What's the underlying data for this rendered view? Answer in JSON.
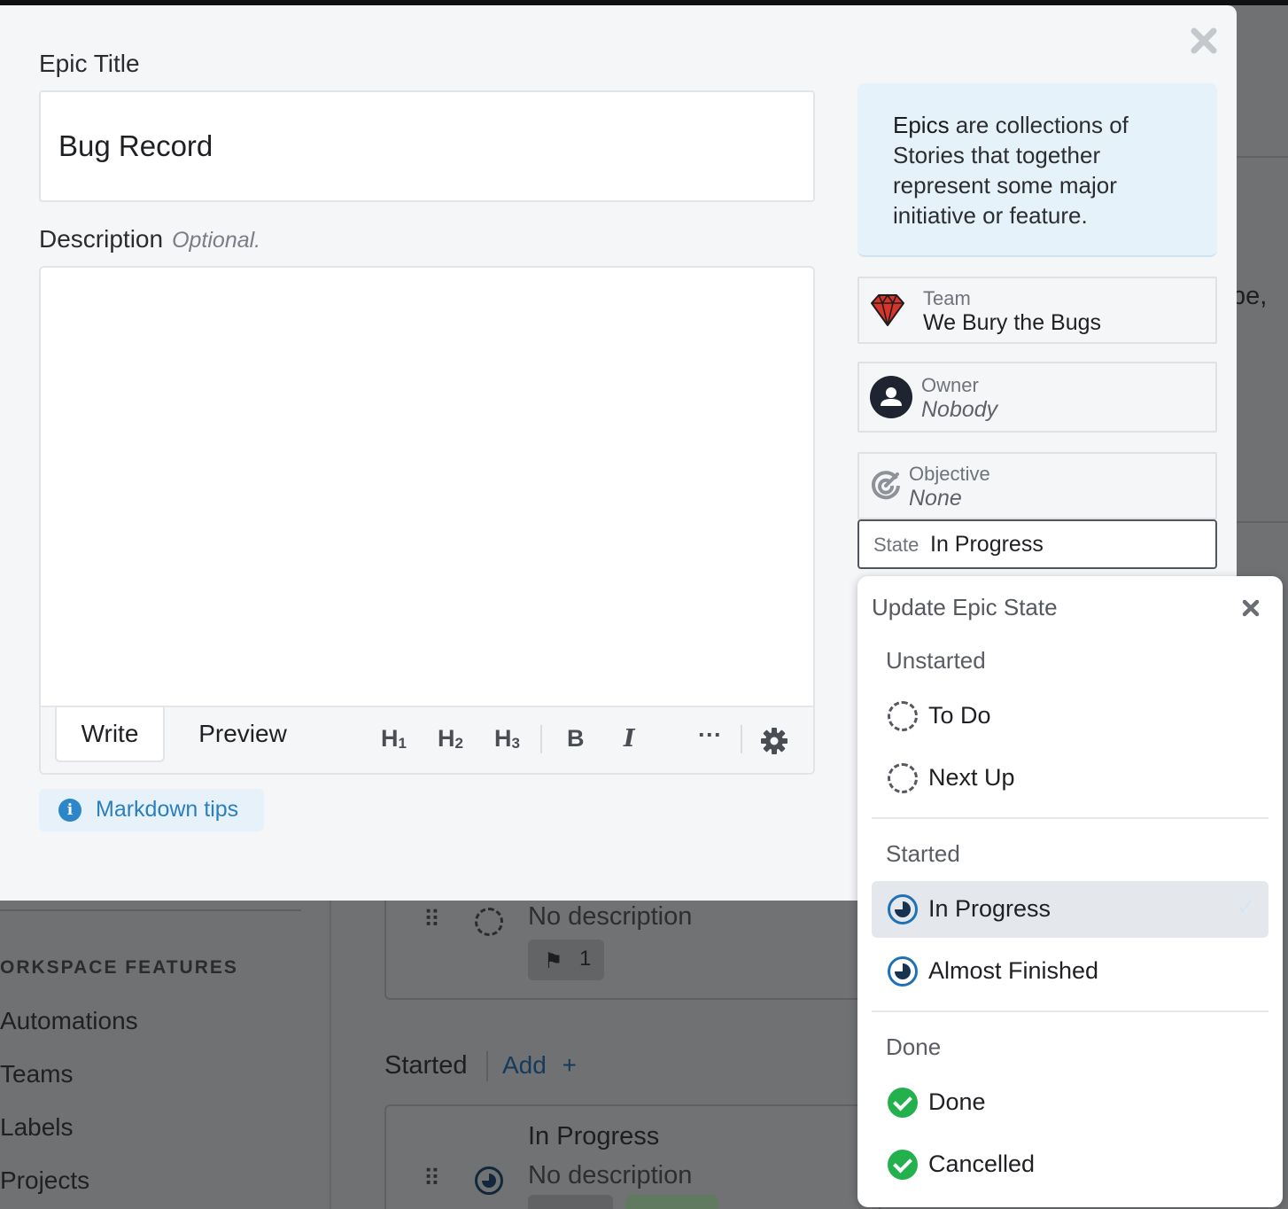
{
  "background": {
    "sidebar_section_title": "ORKSPACE FEATURES",
    "sidebar_items": [
      "Automations",
      "Teams",
      "Labels",
      "Projects"
    ],
    "card1": {
      "description": "No description",
      "flag_count": "1"
    },
    "column_header": "Started",
    "add_label": "Add",
    "add_icon": "+",
    "card2": {
      "title": "In Progress",
      "description": "No description"
    },
    "right_fragment": "be,"
  },
  "modal": {
    "epic_title_label": "Epic Title",
    "epic_title_value": "Bug Record",
    "description_label": "Description",
    "description_optional": "Optional.",
    "description_value": "",
    "editor": {
      "tabs": [
        "Write",
        "Preview"
      ],
      "tools": {
        "h1": "H",
        "h2": "H",
        "h3": "H",
        "h1_sub": "1",
        "h2_sub": "2",
        "h3_sub": "3",
        "bold": "B",
        "italic": "I",
        "more": "···"
      }
    },
    "markdown_tips": "Markdown tips",
    "help": {
      "strong": "Epics",
      "rest": " are collections of Stories that together represent some major initiative or feature."
    },
    "team": {
      "label": "Team",
      "value": "We Bury the Bugs"
    },
    "owner": {
      "label": "Owner",
      "value": "Nobody"
    },
    "objective": {
      "label": "Objective",
      "value": "None"
    },
    "state": {
      "label": "State",
      "value": "In Progress"
    }
  },
  "dropdown": {
    "title": "Update Epic State",
    "groups": [
      {
        "name": "Unstarted",
        "items": [
          "To Do",
          "Next Up"
        ]
      },
      {
        "name": "Started",
        "items": [
          "In Progress",
          "Almost Finished"
        ]
      },
      {
        "name": "Done",
        "items": [
          "Done",
          "Cancelled"
        ]
      }
    ],
    "selected": "In Progress",
    "check_mark": "✓"
  },
  "colors": {
    "accent_blue": "#2a7fc0",
    "done_green": "#22b14c",
    "ruby_red": "#d9342b"
  }
}
